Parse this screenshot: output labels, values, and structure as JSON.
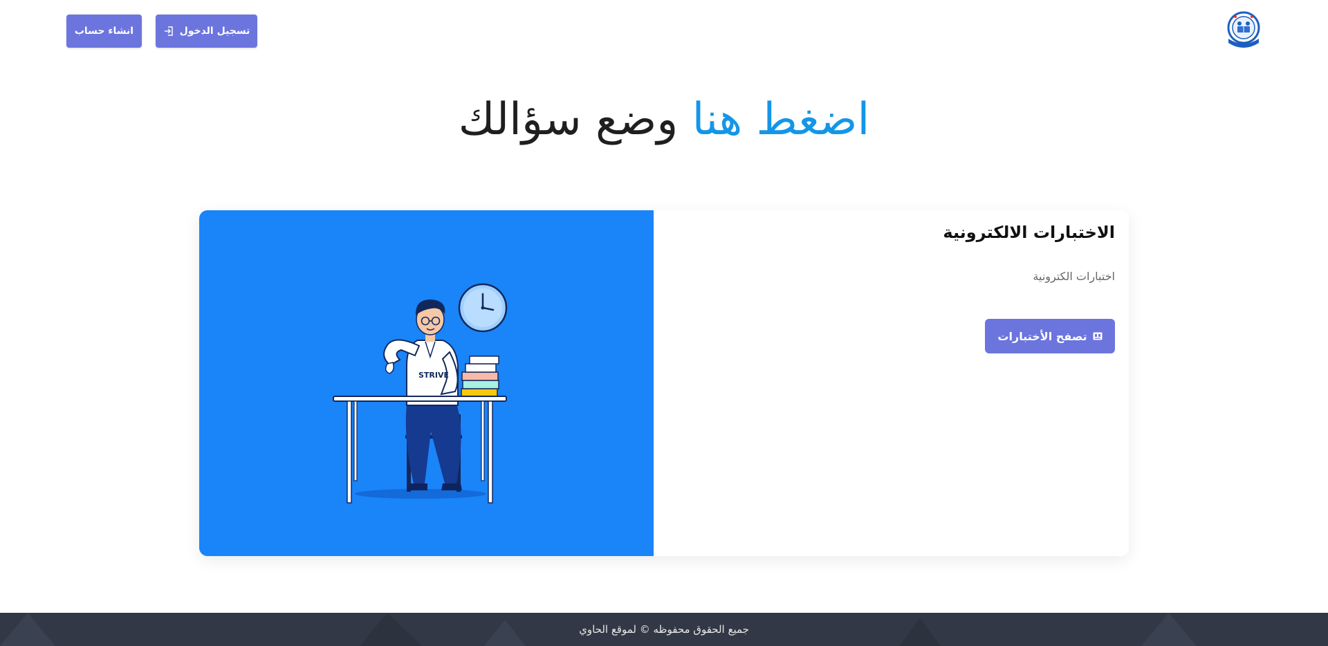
{
  "header": {
    "register_label": "انشاء حساب",
    "login_label": "تسجيل الدخول",
    "login_icon": "sign-in-icon",
    "logo_icon": "school-logo-icon"
  },
  "hero": {
    "highlight": "اضغط هنا",
    "rest": "وضع سؤالك"
  },
  "card": {
    "title": "الاختبارات الالكترونية",
    "description": "اختبارات الكترونية",
    "button_label": "تصفح الأختبارات",
    "button_icon": "exam-icon",
    "illustration_text": "STRIVE"
  },
  "footer": {
    "copyright": "جميع الحقوق محفوظه © لموقع الحاوي"
  },
  "colors": {
    "accent": "#6c75dd",
    "highlight": "#1496e8",
    "image_bg": "#1a84f9",
    "footer_bg": "#323845"
  }
}
